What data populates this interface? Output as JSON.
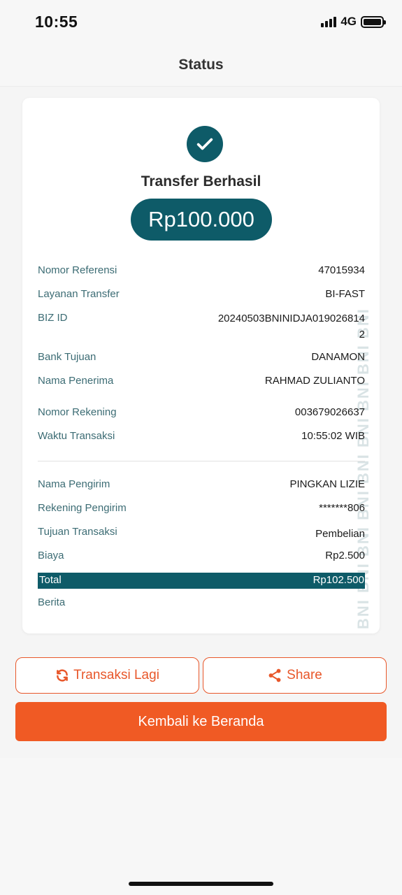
{
  "status_bar": {
    "time": "10:55",
    "network": "4G",
    "icons": [
      "signal-icon",
      "battery-icon"
    ]
  },
  "header": {
    "title": "Status"
  },
  "receipt": {
    "watermark": "BNI BNI BNI BNI BNI BNI BNI BNI BNI",
    "status_icon": "check-icon",
    "title": "Transfer Berhasil",
    "amount": "Rp100.000",
    "details": [
      {
        "label": "Nomor Referensi",
        "value": "47015934"
      },
      {
        "label": "Layanan Transfer",
        "value": "BI-FAST"
      },
      {
        "label": "BIZ ID",
        "value": "20240503BNINIDJA0190268142"
      },
      {
        "label": "Bank Tujuan",
        "value": "DANAMON"
      },
      {
        "label": "Nama Penerima",
        "value": "RAHMAD ZULIANTO"
      },
      {
        "label": "Nomor Rekening",
        "value": "003679026637"
      },
      {
        "label": "Waktu Transaksi",
        "value": "10:55:02 WIB"
      }
    ],
    "sender": [
      {
        "label": "Nama Pengirim",
        "value": "PINGKAN LIZIE"
      },
      {
        "label": "Rekening Pengirim",
        "value": "*******806"
      },
      {
        "label": "Tujuan Transaksi",
        "value": "Pembelian"
      },
      {
        "label": "Biaya",
        "value": "Rp2.500"
      },
      {
        "label": "Total",
        "value": "Rp102.500"
      },
      {
        "label": "Berita",
        "value": ""
      }
    ]
  },
  "actions": {
    "repeat_label": "Transaksi Lagi",
    "repeat_icon": "refresh-icon",
    "share_label": "Share",
    "share_icon": "share-icon",
    "home_label": "Kembali ke Beranda"
  },
  "colors": {
    "primary_teal": "#0e5b68",
    "accent_orange": "#f05a24"
  }
}
